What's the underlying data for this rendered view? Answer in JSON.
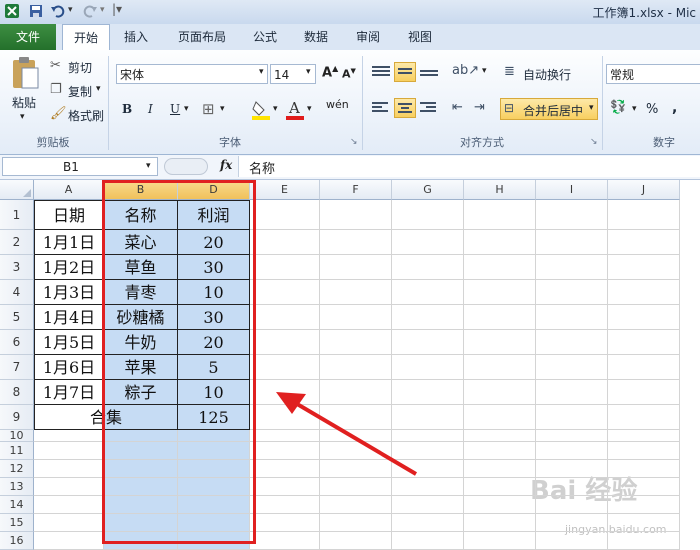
{
  "titlebar": {
    "title": "工作簿1.xlsx - Mic",
    "qa_icons": [
      "excel-icon",
      "save-icon",
      "undo-icon",
      "redo-icon",
      "customize-icon"
    ]
  },
  "tabs": [
    "文件",
    "开始",
    "插入",
    "页面布局",
    "公式",
    "数据",
    "审阅",
    "视图"
  ],
  "clipboard": {
    "paste": "粘贴",
    "cut": "剪切",
    "copy": "复制",
    "format_painter": "格式刷",
    "group": "剪贴板"
  },
  "font": {
    "name": "宋体",
    "size": "14",
    "bold": "B",
    "italic": "I",
    "underline": "U",
    "wen": "wén",
    "group": "字体"
  },
  "align": {
    "wrap": "自动换行",
    "merge": "合并后居中",
    "group": "对齐方式"
  },
  "number": {
    "format": "常规",
    "percent": "%",
    "comma": ",",
    "group": "数字"
  },
  "formula": {
    "namebox": "B1",
    "fx": "fx",
    "content": "名称"
  },
  "grid": {
    "columns": [
      "A",
      "B",
      "D",
      "E",
      "F",
      "G",
      "H",
      "I",
      "J"
    ],
    "rows": [
      "1",
      "2",
      "3",
      "4",
      "5",
      "6",
      "7",
      "8",
      "9",
      "10",
      "11",
      "12",
      "13",
      "14",
      "15",
      "16"
    ],
    "header": {
      "date": "日期",
      "name": "名称",
      "profit": "利润"
    },
    "data": [
      {
        "date": "1月1日",
        "name": "菜心",
        "profit": "20"
      },
      {
        "date": "1月2日",
        "name": "草鱼",
        "profit": "30"
      },
      {
        "date": "1月3日",
        "name": "青枣",
        "profit": "10"
      },
      {
        "date": "1月4日",
        "name": "砂糖橘",
        "profit": "30"
      },
      {
        "date": "1月5日",
        "name": "牛奶",
        "profit": "20"
      },
      {
        "date": "1月6日",
        "name": "苹果",
        "profit": "5"
      },
      {
        "date": "1月7日",
        "name": "粽子",
        "profit": "10"
      }
    ],
    "total_label": "合集",
    "total_value": "125"
  },
  "watermark": {
    "text": "Bai 经验",
    "sub": "jingyan.baidu.com"
  },
  "colors": {
    "annotation": "#e02020",
    "selection": "#c6dcf4",
    "file_tab": "#2a7a31"
  }
}
